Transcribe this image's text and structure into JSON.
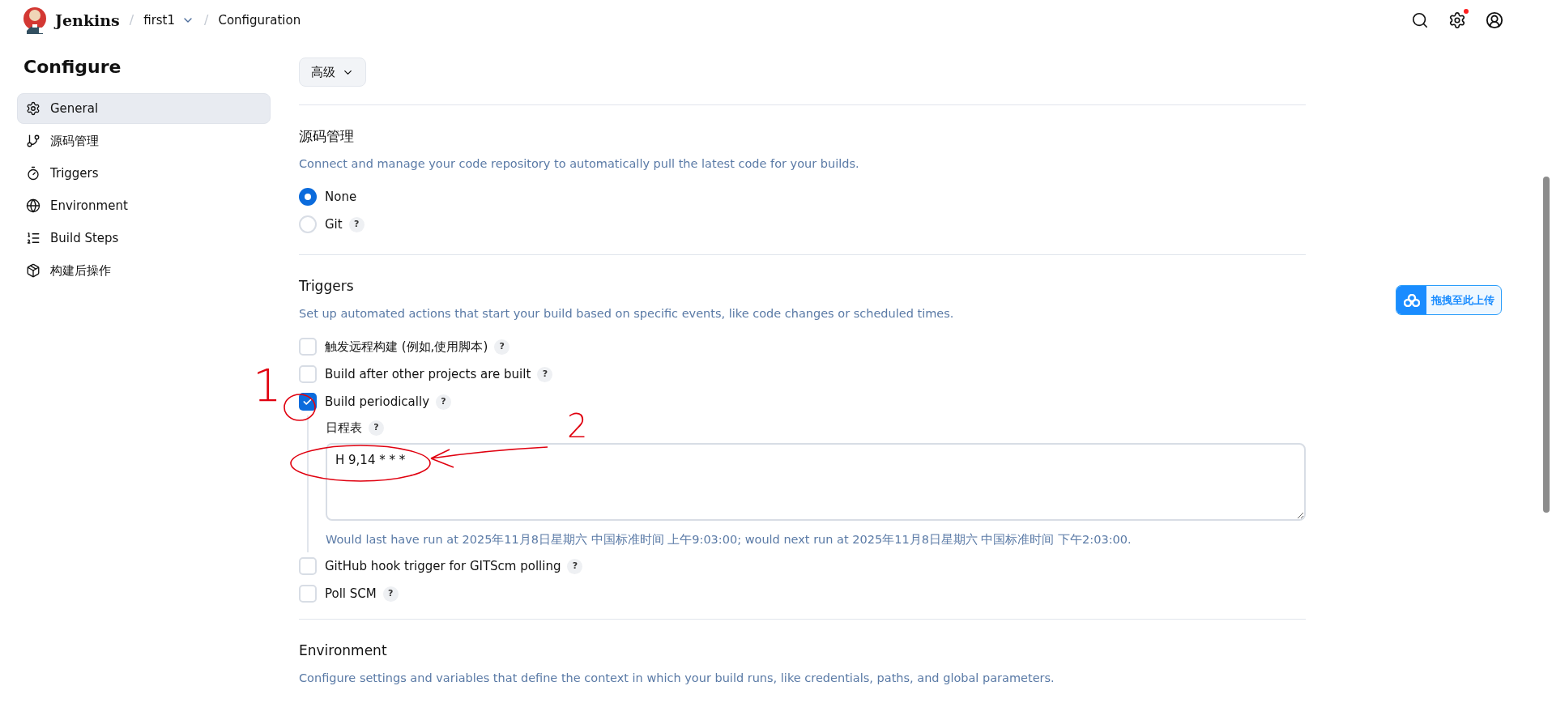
{
  "breadcrumb": {
    "app": "Jenkins",
    "items": [
      {
        "separator": "/",
        "label": "first1",
        "dropdown": true
      },
      {
        "separator": "/",
        "label": "Configuration"
      }
    ]
  },
  "header": {
    "settings_notification": true
  },
  "sidebar": {
    "title": "Configure",
    "items": [
      {
        "label": "General",
        "selected": true
      },
      {
        "label": "源码管理",
        "selected": false
      },
      {
        "label": "Triggers",
        "selected": false
      },
      {
        "label": "Environment",
        "selected": false
      },
      {
        "label": "Build Steps",
        "selected": false
      },
      {
        "label": "构建后操作",
        "selected": false
      }
    ]
  },
  "advanced_button": {
    "label": "高级"
  },
  "sections": [
    {
      "kind": "radio",
      "title": "源码管理",
      "description": "Connect and manage your code repository to automatically pull the latest code for your builds.",
      "options": [
        {
          "label": "None",
          "selected": true
        },
        {
          "label": "Git",
          "selected": false,
          "help": "?"
        }
      ]
    },
    {
      "kind": "checkbox",
      "title": "Triggers",
      "description": "Set up automated actions that start your build based on specific events, like code changes or scheduled times.",
      "options": [
        {
          "label": "触发远程构建 (例如,使用脚本)",
          "checked": false,
          "help": "?"
        },
        {
          "label": "Build after other projects are built",
          "checked": false,
          "help": "?"
        },
        {
          "label": "Build periodically",
          "checked": true,
          "help": "?",
          "schedule": {
            "label": "日程表",
            "help": "?",
            "value": "H 9,14 * * *",
            "note": "Would last have run at 2025年11月8日星期六 中国标准时间 上午9:03:00; would next run at 2025年11月8日星期六 中国标准时间 下午2:03:00."
          }
        },
        {
          "label": "GitHub hook trigger for GITScm polling",
          "checked": false,
          "help": "?"
        },
        {
          "label": "Poll SCM",
          "checked": false,
          "help": "?"
        }
      ]
    },
    {
      "title": "Environment",
      "description": "Configure settings and variables that define the context in which your build runs, like credentials, paths, and global parameters."
    }
  ],
  "upload_widget": {
    "label": "拖拽至此上传"
  },
  "annotations": [
    {
      "label": "1"
    },
    {
      "label": "2"
    }
  ]
}
